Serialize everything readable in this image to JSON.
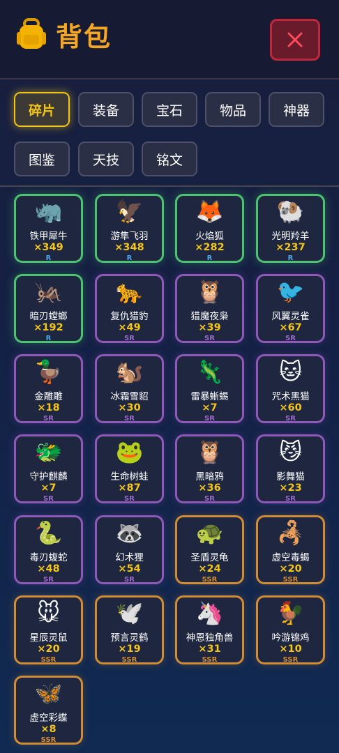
{
  "header": {
    "title": "背包",
    "close_icon": "close-icon",
    "bag_icon": "backpack-icon"
  },
  "colors": {
    "accent": "#f5a623",
    "rarity_R": "#4cc36f",
    "rarity_SR": "#8e59b8",
    "rarity_SSR": "#d18c36",
    "close_bg": "#6a1b2b"
  },
  "tabs": [
    {
      "label": "碎片",
      "active": true
    },
    {
      "label": "装备",
      "active": false
    },
    {
      "label": "宝石",
      "active": false
    },
    {
      "label": "物品",
      "active": false
    },
    {
      "label": "神器",
      "active": false
    },
    {
      "label": "图鉴",
      "active": false
    },
    {
      "label": "天技",
      "active": false
    },
    {
      "label": "铭文",
      "active": false
    }
  ],
  "items": [
    {
      "emoji": "🦏",
      "name": "铁甲犀牛",
      "count": "×349",
      "rarity": "R"
    },
    {
      "emoji": "🦅",
      "name": "游隼飞羽",
      "count": "×348",
      "rarity": "R"
    },
    {
      "emoji": "🦊",
      "name": "火焰狐",
      "count": "×282",
      "rarity": "R"
    },
    {
      "emoji": "🐏",
      "name": "光明羚羊",
      "count": "×237",
      "rarity": "R"
    },
    {
      "emoji": "🦗",
      "name": "暗刃螳螂",
      "count": "×192",
      "rarity": "R"
    },
    {
      "emoji": "🐆",
      "name": "复仇猎豹",
      "count": "×49",
      "rarity": "SR"
    },
    {
      "emoji": "🦉",
      "name": "猎魔夜枭",
      "count": "×39",
      "rarity": "SR"
    },
    {
      "emoji": "🐦",
      "name": "风翼灵雀",
      "count": "×67",
      "rarity": "SR"
    },
    {
      "emoji": "🦆",
      "name": "金雕雕",
      "count": "×18",
      "rarity": "SR"
    },
    {
      "emoji": "🐿️",
      "name": "冰霜雪貂",
      "count": "×30",
      "rarity": "SR"
    },
    {
      "emoji": "🦎",
      "name": "雷暴蜥蜴",
      "count": "×7",
      "rarity": "SR"
    },
    {
      "emoji": "🐱",
      "name": "咒术黑猫",
      "count": "×60",
      "rarity": "SR"
    },
    {
      "emoji": "🐲",
      "name": "守护麒麟",
      "count": "×7",
      "rarity": "SR"
    },
    {
      "emoji": "🐸",
      "name": "生命树蛙",
      "count": "×87",
      "rarity": "SR"
    },
    {
      "emoji": "🦉",
      "name": "黑暗鸦",
      "count": "×36",
      "rarity": "SR"
    },
    {
      "emoji": "😼",
      "name": "影舞猫",
      "count": "×23",
      "rarity": "SR"
    },
    {
      "emoji": "🐍",
      "name": "毒刃蝮蛇",
      "count": "×48",
      "rarity": "SR"
    },
    {
      "emoji": "🦝",
      "name": "幻术狸",
      "count": "×54",
      "rarity": "SR"
    },
    {
      "emoji": "🐢",
      "name": "圣盾灵龟",
      "count": "×24",
      "rarity": "SSR"
    },
    {
      "emoji": "🦂",
      "name": "虚空毒蝎",
      "count": "×20",
      "rarity": "SSR"
    },
    {
      "emoji": "🐭",
      "name": "星辰灵鼠",
      "count": "×20",
      "rarity": "SSR"
    },
    {
      "emoji": "🕊️",
      "name": "预言灵鹤",
      "count": "×19",
      "rarity": "SSR"
    },
    {
      "emoji": "🦄",
      "name": "神恩独角兽",
      "count": "×31",
      "rarity": "SSR"
    },
    {
      "emoji": "🐓",
      "name": "吟游锦鸡",
      "count": "×10",
      "rarity": "SSR"
    },
    {
      "emoji": "🦋",
      "name": "虚空彩蝶",
      "count": "×8",
      "rarity": "SSR"
    }
  ]
}
